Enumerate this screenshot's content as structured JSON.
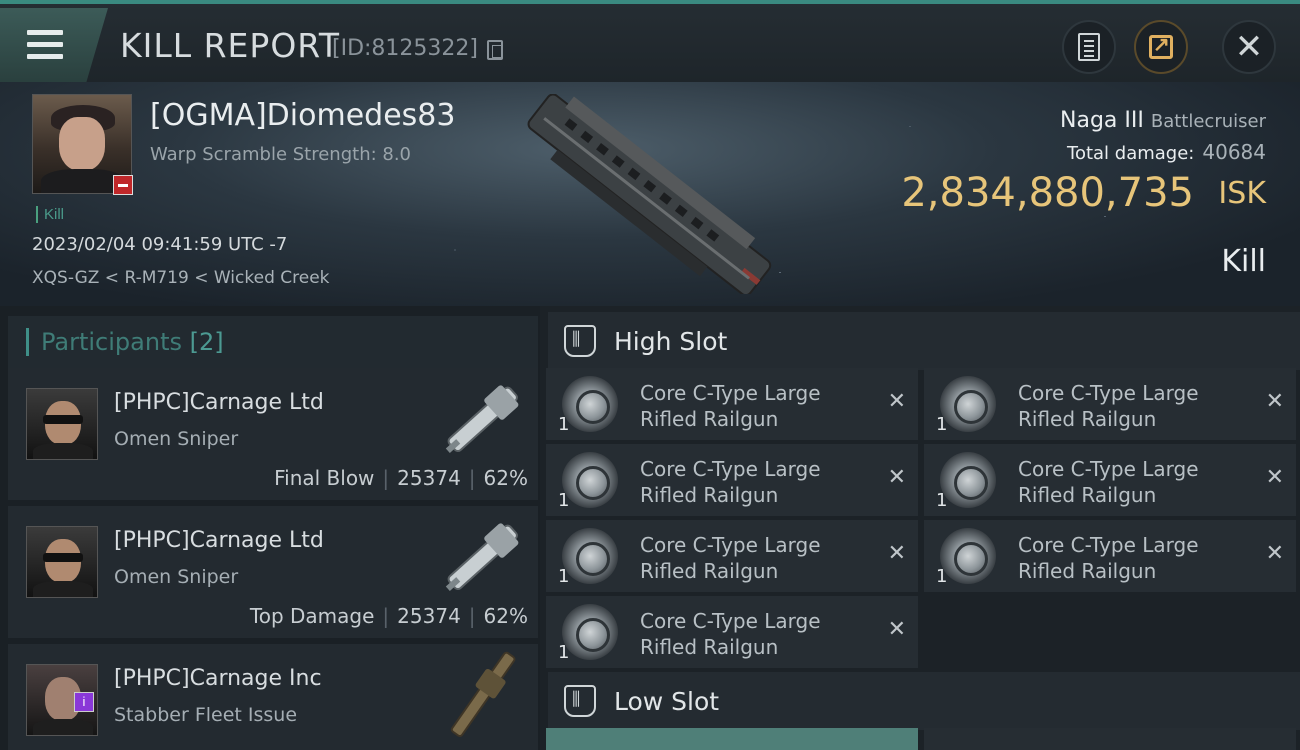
{
  "header": {
    "title": "KILL REPORT",
    "report_id": "[ID:8125322]"
  },
  "victim": {
    "name": "[OGMA]Diomedes83",
    "warp_scramble": "Warp Scramble Strength: 8.0",
    "tag": "Kill",
    "time": "2023/02/04 09:41:59 UTC -7",
    "location": "XQS-GZ < R-M719 < Wicked Creek",
    "ship": "Naga III",
    "ship_class": "Battlecruiser",
    "total_damage_label": "Total damage:",
    "total_damage": "40684",
    "isk_value": "2,834,880,735",
    "isk_unit": "ISK",
    "result": "Kill"
  },
  "participants": {
    "label": "Participants",
    "count": "[2]",
    "rows": [
      {
        "name": "[PHPC]Carnage Ltd",
        "ship": "Omen Sniper",
        "role": "Final Blow",
        "damage": "25374",
        "percent": "62%"
      },
      {
        "name": "[PHPC]Carnage Ltd",
        "ship": "Omen Sniper",
        "role": "Top Damage",
        "damage": "25374",
        "percent": "62%"
      },
      {
        "name": "[PHPC]Carnage Inc",
        "ship": "Stabber Fleet Issue"
      }
    ]
  },
  "fittings": {
    "high_slot_label": "High Slot",
    "low_slot_label": "Low Slot",
    "high_slot": [
      {
        "qty": "1",
        "name_line1": "Core C-Type Large",
        "name_line2": "Rifled Railgun"
      },
      {
        "qty": "1",
        "name_line1": "Core C-Type Large",
        "name_line2": "Rifled Railgun"
      },
      {
        "qty": "1",
        "name_line1": "Core C-Type Large",
        "name_line2": "Rifled Railgun"
      },
      {
        "qty": "1",
        "name_line1": "Core C-Type Large",
        "name_line2": "Rifled Railgun"
      },
      {
        "qty": "1",
        "name_line1": "Core C-Type Large",
        "name_line2": "Rifled Railgun"
      },
      {
        "qty": "1",
        "name_line1": "Core C-Type Large",
        "name_line2": "Rifled Railgun"
      },
      {
        "qty": "1",
        "name_line1": "Core C-Type Large",
        "name_line2": "Rifled Railgun"
      }
    ]
  },
  "colors": {
    "accent": "#3f8f88",
    "isk": "#e7c57a",
    "share": "#e0b060",
    "badge_red": "#c0282a",
    "badge_purple": "#8a38d8"
  },
  "icons": [
    "menu-icon",
    "copy-icon",
    "clipboard-icon",
    "share-icon",
    "close-icon",
    "high-slot-icon",
    "low-slot-icon",
    "remove-icon"
  ]
}
